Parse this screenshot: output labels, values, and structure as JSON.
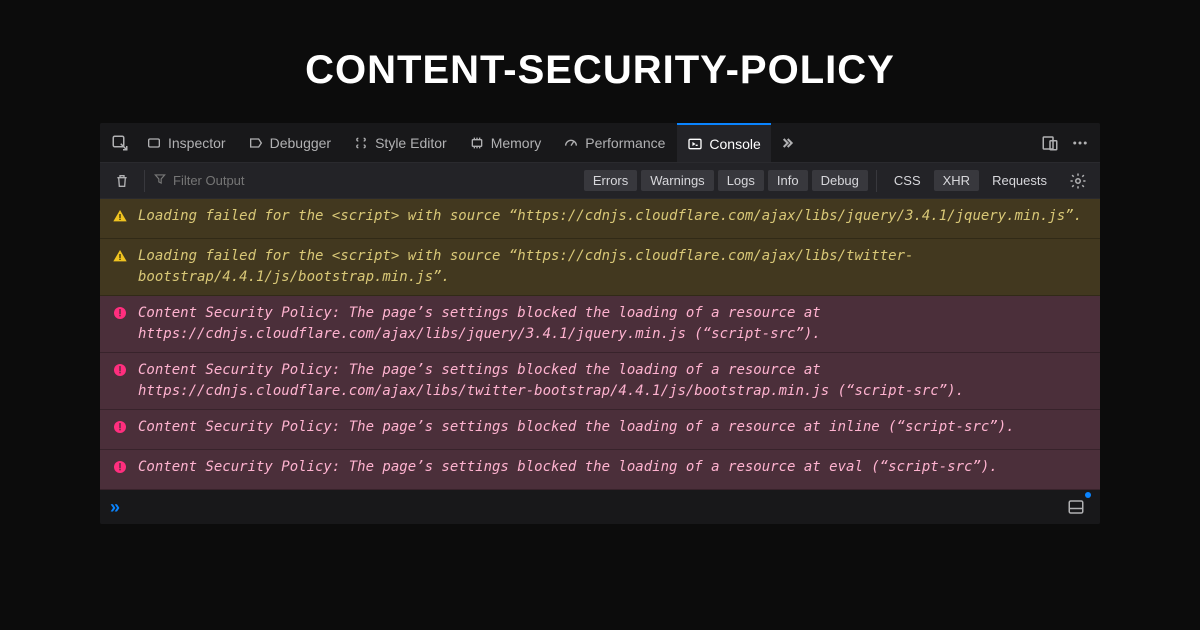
{
  "title": "CONTENT-SECURITY-POLICY",
  "tabs": {
    "inspector": "Inspector",
    "debugger": "Debugger",
    "style_editor": "Style Editor",
    "memory": "Memory",
    "performance": "Performance",
    "console": "Console"
  },
  "toolbar": {
    "filter_placeholder": "Filter Output",
    "errors": "Errors",
    "warnings": "Warnings",
    "logs": "Logs",
    "info": "Info",
    "debug": "Debug",
    "css": "CSS",
    "xhr": "XHR",
    "requests": "Requests"
  },
  "messages": [
    {
      "type": "warn",
      "text": "Loading failed for the <script> with source “https://cdnjs.cloudflare.com/ajax/libs/jquery/3.4.1/jquery.min.js”."
    },
    {
      "type": "warn",
      "text": "Loading failed for the <script> with source “https://cdnjs.cloudflare.com/ajax/libs/twitter-bootstrap/4.4.1/js/bootstrap.min.js”."
    },
    {
      "type": "err",
      "text": "Content Security Policy: The page’s settings blocked the loading of a resource at https://cdnjs.cloudflare.com/ajax/libs/jquery/3.4.1/jquery.min.js (“script-src”)."
    },
    {
      "type": "err",
      "text": "Content Security Policy: The page’s settings blocked the loading of a resource at https://cdnjs.cloudflare.com/ajax/libs/twitter-bootstrap/4.4.1/js/bootstrap.min.js (“script-src”)."
    },
    {
      "type": "err",
      "text": "Content Security Policy: The page’s settings blocked the loading of a resource at inline (“script-src”)."
    },
    {
      "type": "err",
      "text": "Content Security Policy: The page’s settings blocked the loading of a resource at eval (“script-src”)."
    }
  ],
  "prompt": "»"
}
